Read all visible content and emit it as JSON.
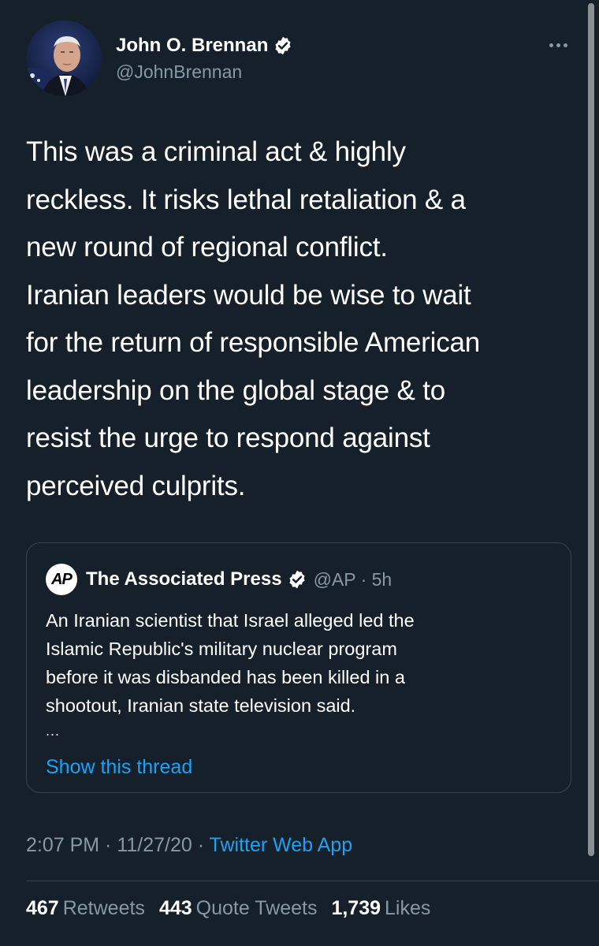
{
  "tweet": {
    "author_name": "John O. Brennan",
    "author_handle": "@JohnBrennan",
    "text_lines": [
      "This was a criminal act & highly",
      "reckless. It risks lethal retaliation & a",
      "new round of regional conflict.",
      "Iranian leaders would be wise to wait",
      "for the return of responsible American",
      "leadership on the global stage & to",
      "resist the urge to respond against",
      "perceived culprits."
    ],
    "timestamp": "2:07 PM · 11/27/20 · ",
    "source_app": "Twitter Web App"
  },
  "quote": {
    "logo_text": "AP",
    "name": "The Associated Press",
    "meta": "@AP · 5h",
    "text_lines": [
      "An Iranian scientist that Israel alleged led the",
      "Islamic Republic's military nuclear program",
      "before it was disbanded has been killed in a",
      "shootout, Iranian state television said."
    ],
    "ellipsis": "...",
    "show_thread": "Show this thread"
  },
  "stats": {
    "retweets_count": "467",
    "retweets_label": "Retweets",
    "quotes_count": "443",
    "quotes_label": "Quote Tweets",
    "likes_count": "1,739",
    "likes_label": "Likes"
  },
  "colors": {
    "background": "#15202b",
    "secondary_text": "#8899a6",
    "accent": "#1da1f2",
    "border": "#38444d"
  }
}
